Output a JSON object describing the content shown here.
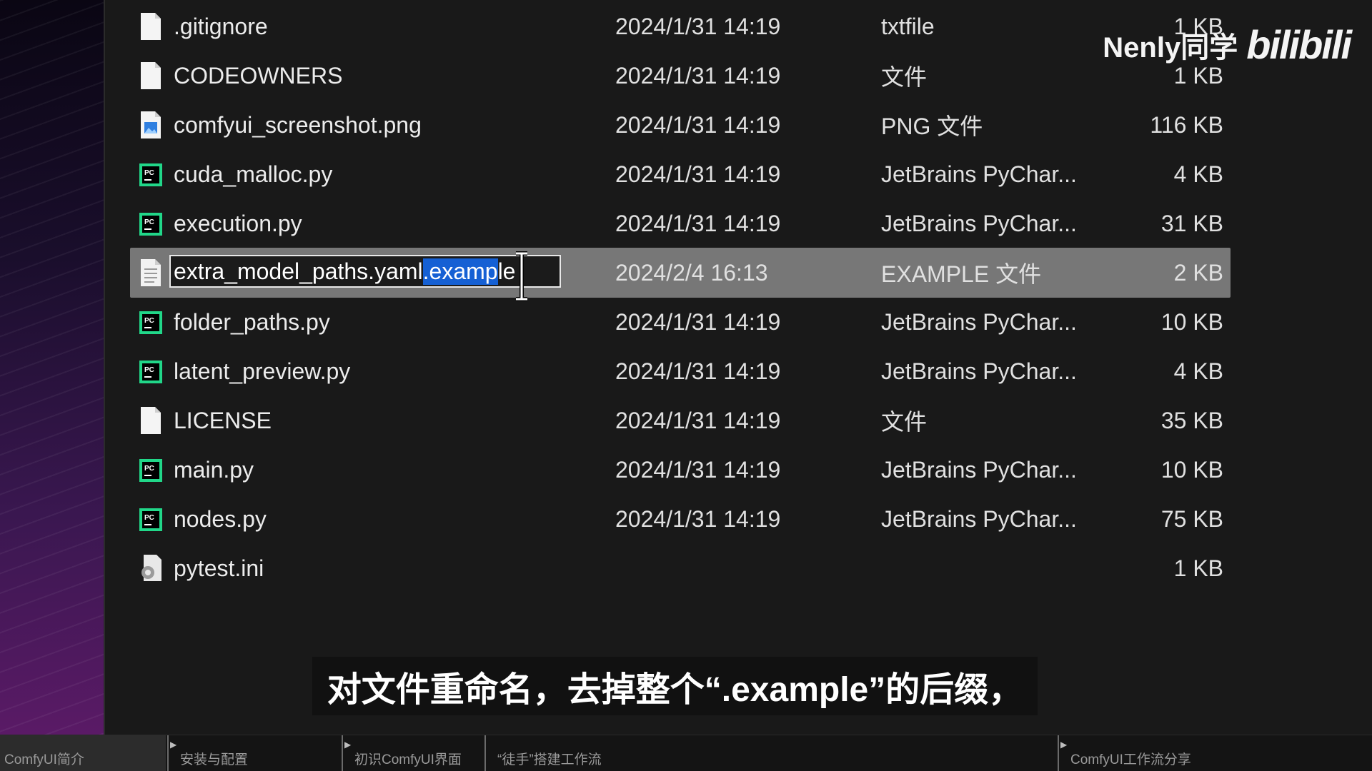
{
  "watermark": {
    "author": "Nenly同学",
    "logo": "bilibili"
  },
  "files": [
    {
      "name": ".gitignore",
      "date": "2024/1/31 14:19",
      "type": "txtfile",
      "size": "1 KB",
      "icon": "blank-file-icon"
    },
    {
      "name": "CODEOWNERS",
      "date": "2024/1/31 14:19",
      "type": "文件",
      "size": "1 KB",
      "icon": "blank-file-icon"
    },
    {
      "name": "comfyui_screenshot.png",
      "date": "2024/1/31 14:19",
      "type": "PNG 文件",
      "size": "116 KB",
      "icon": "image-file-icon"
    },
    {
      "name": "cuda_malloc.py",
      "date": "2024/1/31 14:19",
      "type": "JetBrains PyChar...",
      "size": "4 KB",
      "icon": "pycharm-file-icon"
    },
    {
      "name": "execution.py",
      "date": "2024/1/31 14:19",
      "type": "JetBrains PyChar...",
      "size": "31 KB",
      "icon": "pycharm-file-icon"
    },
    {
      "name": "extra_model_paths.yaml.example",
      "date": "2024/2/4 16:13",
      "type": "EXAMPLE 文件",
      "size": "2 KB",
      "icon": "text-file-icon"
    },
    {
      "name": "folder_paths.py",
      "date": "2024/1/31 14:19",
      "type": "JetBrains PyChar...",
      "size": "10 KB",
      "icon": "pycharm-file-icon"
    },
    {
      "name": "latent_preview.py",
      "date": "2024/1/31 14:19",
      "type": "JetBrains PyChar...",
      "size": "4 KB",
      "icon": "pycharm-file-icon"
    },
    {
      "name": "LICENSE",
      "date": "2024/1/31 14:19",
      "type": "文件",
      "size": "35 KB",
      "icon": "blank-file-icon"
    },
    {
      "name": "main.py",
      "date": "2024/1/31 14:19",
      "type": "JetBrains PyChar...",
      "size": "10 KB",
      "icon": "pycharm-file-icon"
    },
    {
      "name": "nodes.py",
      "date": "2024/1/31 14:19",
      "type": "JetBrains PyChar...",
      "size": "75 KB",
      "icon": "pycharm-file-icon"
    },
    {
      "name": "pytest.ini",
      "date": "",
      "type": "",
      "size": "1 KB",
      "icon": "settings-file-icon"
    }
  ],
  "rename": {
    "prefix": "extra_model_paths.yaml",
    "selected": ".examp",
    "suffix": "le"
  },
  "subtitle": "对文件重命名，去掉整个“.example”的后缀，",
  "chapters": [
    {
      "label": "ComfyUI简介"
    },
    {
      "label": "安装与配置"
    },
    {
      "label": "初识ComfyUI界面"
    },
    {
      "label": "“徒手”搭建工作流"
    },
    {
      "label": "ComfyUI工作流分享"
    }
  ],
  "colors": {
    "selection_row": "#777777",
    "text_selection": "#1560d4",
    "pycharm_green": "#21d789"
  }
}
